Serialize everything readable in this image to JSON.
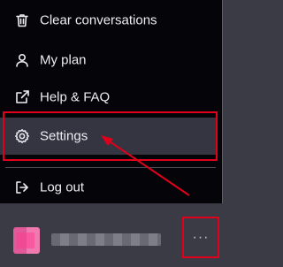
{
  "menu": {
    "items": [
      {
        "label": "Clear conversations",
        "icon": "trash-icon"
      },
      {
        "label": "My plan",
        "icon": "user-icon"
      },
      {
        "label": "Help & FAQ",
        "icon": "external-link-icon"
      },
      {
        "label": "Settings",
        "icon": "gear-icon"
      },
      {
        "label": "Log out",
        "icon": "logout-icon"
      }
    ]
  },
  "footer": {
    "more_label": "···"
  },
  "colors": {
    "menu_background": "#050509",
    "hover_background": "#343541",
    "annotation_red": "#e0001b",
    "text": "#ececf1"
  }
}
